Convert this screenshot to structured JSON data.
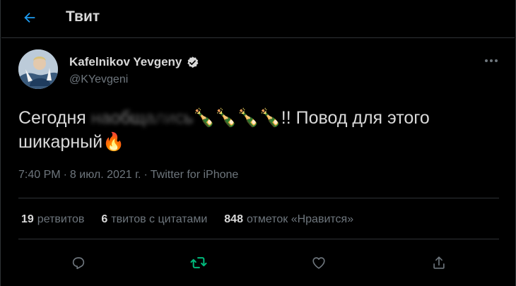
{
  "header": {
    "title": "Твит"
  },
  "tweet": {
    "author": {
      "display_name": "Kafelnikov Yevgeny",
      "handle": "@KYevgeni",
      "verified": true
    },
    "text": {
      "part1": "Сегодня ",
      "blurred": "наобщались",
      "emojis": "🍾🍾🍾🍾",
      "part2": "!! Повод для этого шикарный",
      "emoji_end": "🔥"
    },
    "meta": {
      "time": "7:40 PM",
      "sep1": "·",
      "date": "8 июл. 2021 г.",
      "sep2": "·",
      "source": "Twitter for iPhone"
    },
    "stats": {
      "retweets_count": "19",
      "retweets_label": "ретвитов",
      "quotes_count": "6",
      "quotes_label": "твитов с цитатами",
      "likes_count": "848",
      "likes_label": "отметок «Нравится»"
    }
  },
  "icons": {
    "back": "back-arrow-icon",
    "verified": "verified-badge-icon",
    "more": "more-dots-icon",
    "reply": "reply-icon",
    "retweet": "retweet-icon",
    "like": "heart-icon",
    "share": "share-icon"
  },
  "colors": {
    "background": "#000000",
    "accent": "#1d9bf0",
    "retweeted": "#00ba7c",
    "text_primary": "#d9d9d9",
    "text_secondary": "#6e767d",
    "divider": "#2f3336"
  }
}
